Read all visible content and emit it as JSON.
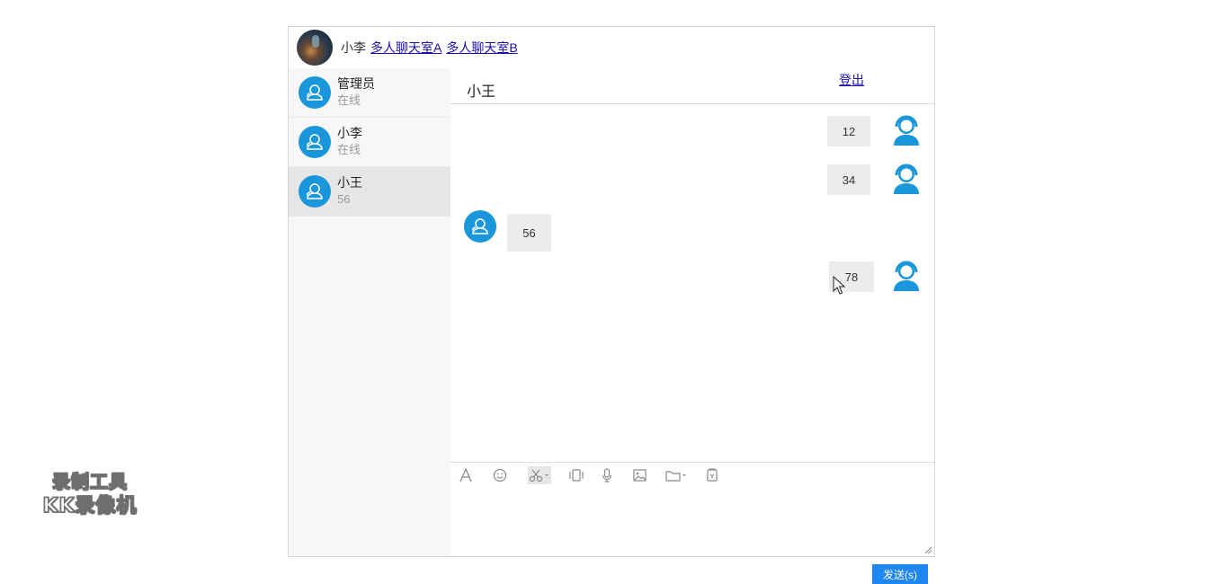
{
  "top_bar": {
    "user_name": "小李",
    "rooms": [
      "多人聊天室A",
      "多人聊天室B"
    ]
  },
  "contacts": [
    {
      "name": "管理员",
      "status": "在线",
      "active": false
    },
    {
      "name": "小李",
      "status": "在线",
      "active": false
    },
    {
      "name": "小王",
      "status": "56",
      "active": true
    }
  ],
  "chat": {
    "title": "小王",
    "logout_label": "登出",
    "messages": [
      {
        "text": "12",
        "side": "right"
      },
      {
        "text": "34",
        "side": "right"
      },
      {
        "text": "56",
        "side": "left"
      },
      {
        "text": "78",
        "side": "right"
      }
    ]
  },
  "toolbar": {
    "tools": [
      "font-icon",
      "emoji-icon",
      "scissors-icon",
      "shake-icon",
      "microphone-icon",
      "image-icon",
      "folder-icon",
      "history-icon"
    ]
  },
  "send_label": "发送(s)",
  "watermark": {
    "line1": "录制工具",
    "line2": "KK录像机"
  },
  "colors": {
    "accent": "#1a96db",
    "send_button": "#1e87f0",
    "link": "#1a0dab"
  }
}
